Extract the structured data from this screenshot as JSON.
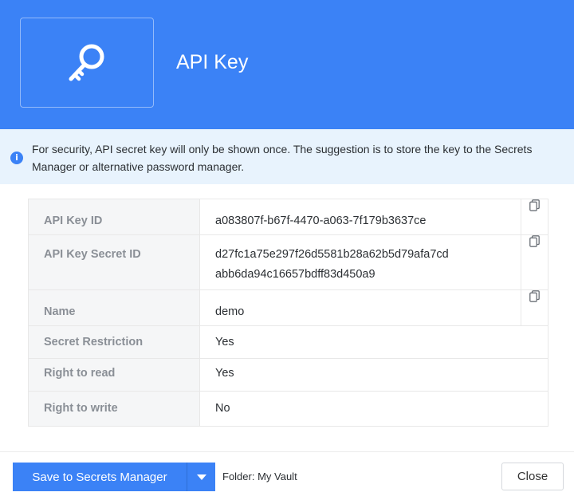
{
  "dialog": {
    "title": "API Key",
    "icon": "key-icon",
    "notice": "For security, API secret key will only be shown once. The suggestion is to store the key to the Secrets Manager or alternative password manager."
  },
  "details": {
    "api_key_id": {
      "label": "API Key ID",
      "value": "a083807f-b67f-4470-a063-7f179b3637ce"
    },
    "api_key_secret_id": {
      "label": "API Key Secret ID",
      "value_line1": "d27fc1a75e297f26d5581b28a62b5d79afa7cd",
      "value_line2": "abb6da94c16657bdff83d450a9"
    },
    "name": {
      "label": "Name",
      "value": "demo"
    },
    "secret_restriction": {
      "label": "Secret Restriction",
      "value": "Yes"
    },
    "right_to_read": {
      "label": "Right to read",
      "value": "Yes"
    },
    "right_to_write": {
      "label": "Right to write",
      "value": "No"
    }
  },
  "footer": {
    "save_label": "Save to Secrets Manager",
    "folder_label": "Folder: My Vault",
    "close_label": "Close"
  },
  "colors": {
    "primary": "#3b82f6",
    "notice_bg": "#e8f3fd",
    "label_bg": "#f5f6f7"
  }
}
